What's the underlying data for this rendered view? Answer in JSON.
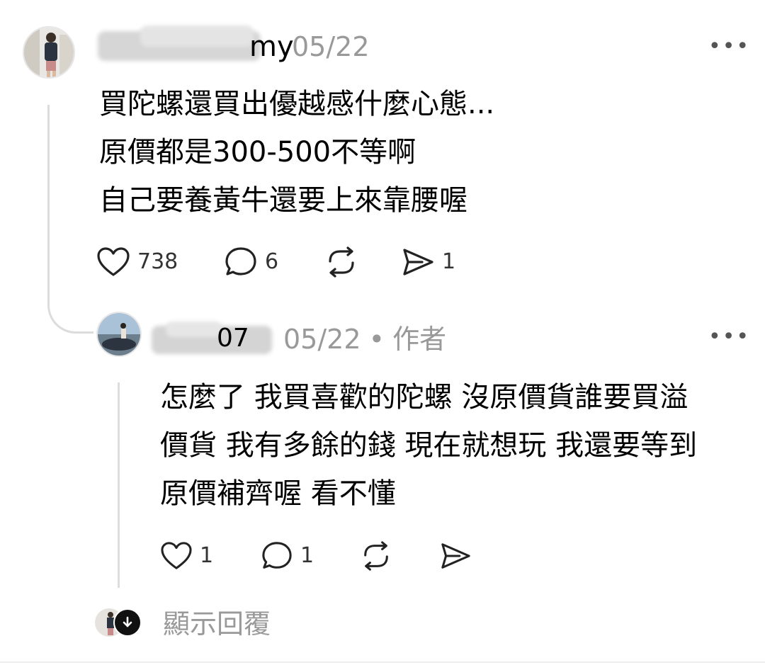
{
  "post": {
    "username_visible": "my",
    "date": "05/22",
    "more_label": "•••",
    "lines": [
      "買陀螺還買出優越感什麼心態...",
      "原價都是300-500不等啊",
      "自己要養黃牛還要上來靠腰喔"
    ],
    "likes": "738",
    "comments": "6",
    "shares": "1",
    "icons": [
      "heart-icon",
      "comment-icon",
      "repost-icon",
      "send-icon"
    ]
  },
  "reply": {
    "username_visible": "07",
    "date": "05/22",
    "separator": "•",
    "author_tag": "作者",
    "more_label": "•••",
    "lines": [
      "怎麼了 我買喜歡的陀螺 沒原價貨誰要買溢",
      "價貨 我有多餘的錢 現在就想玩 我還要等到",
      "原價補齊喔 看不懂"
    ],
    "likes": "1",
    "comments": "1",
    "icons": [
      "heart-icon",
      "comment-icon",
      "repost-icon",
      "send-icon"
    ]
  },
  "show_replies": {
    "label": "顯示回覆",
    "icon": "arrow-down-icon"
  },
  "colors": {
    "text": "#000000",
    "muted": "#999999",
    "thread_line": "#dcdcdc"
  }
}
